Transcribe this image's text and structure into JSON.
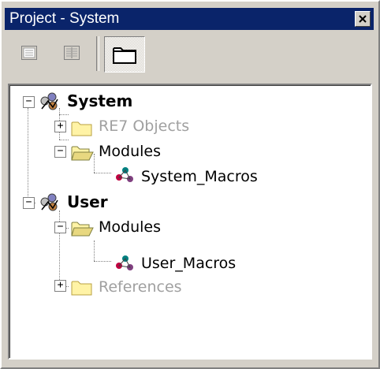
{
  "window": {
    "title": "Project - System"
  },
  "toolbar": {
    "buttons": [
      {
        "icon": "properties-icon"
      },
      {
        "icon": "split-view-icon"
      },
      {
        "icon": "folder-view-icon",
        "pressed": true
      }
    ]
  },
  "tree": {
    "nodes": [
      {
        "label": "System",
        "bold": true,
        "expanded": true,
        "icon": "project-icon"
      },
      {
        "label": "RE7 Objects",
        "disabled": true,
        "expanded": false,
        "icon": "folder-closed-icon"
      },
      {
        "label": "Modules",
        "expanded": true,
        "icon": "folder-open-icon"
      },
      {
        "label": "System_Macros",
        "icon": "macro-module-icon"
      },
      {
        "label": "User",
        "bold": true,
        "expanded": true,
        "icon": "project-icon"
      },
      {
        "label": "Modules",
        "expanded": true,
        "icon": "folder-open-icon"
      },
      {
        "label": "User_Macros",
        "icon": "macro-module-icon"
      },
      {
        "label": "References",
        "disabled": true,
        "expanded": false,
        "icon": "folder-closed-icon"
      }
    ]
  },
  "colors": {
    "titlebar": "#0a246a",
    "face": "#d4d0c8",
    "disabled_text": "#a0a0a0"
  }
}
